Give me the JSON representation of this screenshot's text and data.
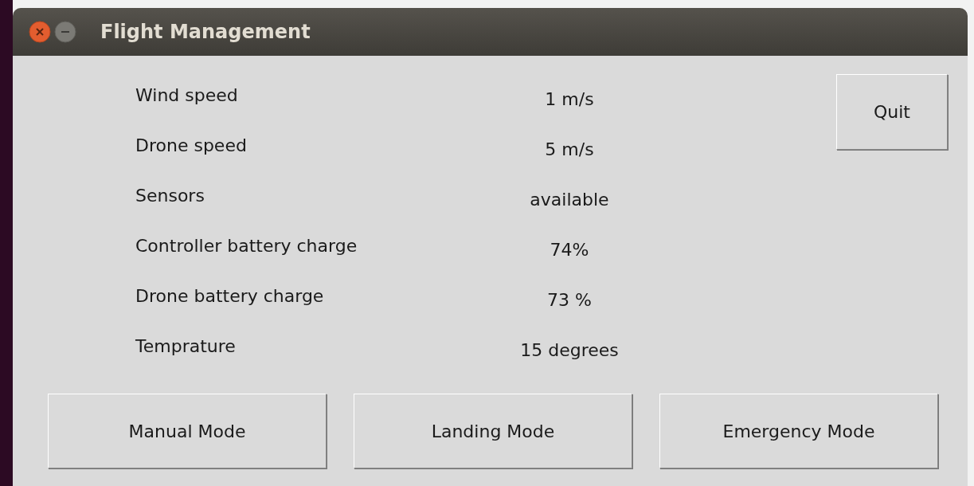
{
  "window": {
    "title": "Flight Management"
  },
  "readings": [
    {
      "label": "Wind speed",
      "value": "1 m/s"
    },
    {
      "label": "Drone speed",
      "value": "5 m/s"
    },
    {
      "label": "Sensors",
      "value": "available"
    },
    {
      "label": "Controller battery charge",
      "value": "74%"
    },
    {
      "label": "Drone battery charge",
      "value": "73 %"
    },
    {
      "label": "Temprature",
      "value": "15 degrees"
    }
  ],
  "quit_button": "Quit",
  "mode_buttons": [
    "Manual Mode",
    "Landing Mode",
    "Emergency Mode"
  ]
}
